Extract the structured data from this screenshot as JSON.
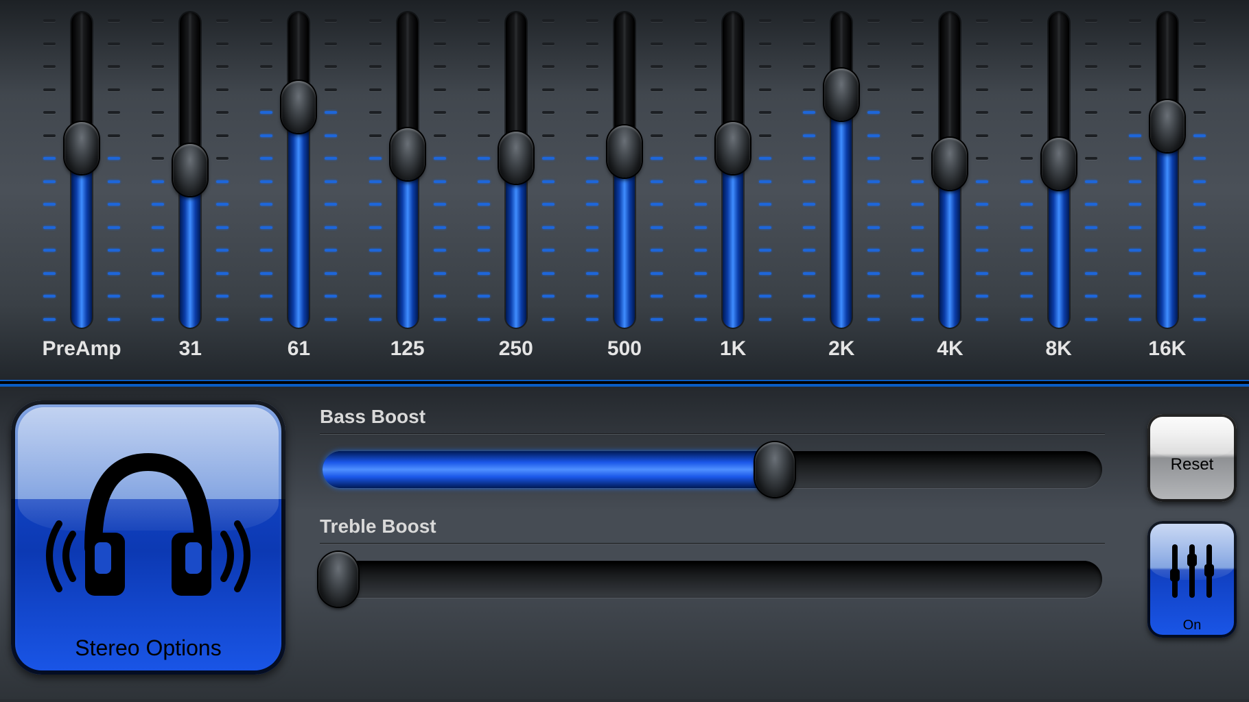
{
  "equalizer": {
    "track_ticks": 14,
    "channels": [
      {
        "id": "preamp",
        "label": "PreAmp",
        "value_pct": 57
      },
      {
        "id": "31",
        "label": "31",
        "value_pct": 50
      },
      {
        "id": "61",
        "label": "61",
        "value_pct": 70
      },
      {
        "id": "125",
        "label": "125",
        "value_pct": 55
      },
      {
        "id": "250",
        "label": "250",
        "value_pct": 54
      },
      {
        "id": "500",
        "label": "500",
        "value_pct": 56
      },
      {
        "id": "1k",
        "label": "1K",
        "value_pct": 57
      },
      {
        "id": "2k",
        "label": "2K",
        "value_pct": 74
      },
      {
        "id": "4k",
        "label": "4K",
        "value_pct": 52
      },
      {
        "id": "8k",
        "label": "8K",
        "value_pct": 52
      },
      {
        "id": "16k",
        "label": "16K",
        "value_pct": 64
      }
    ]
  },
  "boost": {
    "bass": {
      "label": "Bass Boost",
      "value_pct": 58
    },
    "treble": {
      "label": "Treble Boost",
      "value_pct": 2
    }
  },
  "buttons": {
    "stereo_options": "Stereo Options",
    "reset": "Reset",
    "on": "On"
  },
  "colors": {
    "accent_blue": "#1a56e8",
    "track_dark": "#17191b",
    "text": "#e5e5e5"
  }
}
